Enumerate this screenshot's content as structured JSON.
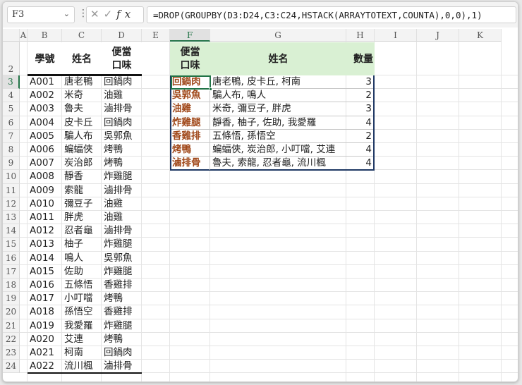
{
  "formula_bar": {
    "name_box": "F3",
    "cancel": "✕",
    "enter": "✓",
    "fx": "fx",
    "formula": "=DROP(GROUPBY(D3:D24,C3:C24,HSTACK(ARRAYTOTEXT,COUNTA),0,0),1)"
  },
  "columns": [
    "A",
    "B",
    "C",
    "D",
    "E",
    "F",
    "G",
    "H",
    "I",
    "J",
    "K"
  ],
  "rows": [
    "2",
    "3",
    "4",
    "5",
    "6",
    "7",
    "8",
    "9",
    "10",
    "11",
    "12",
    "13",
    "14",
    "15",
    "16",
    "17",
    "18",
    "19",
    "20",
    "21",
    "22",
    "23",
    "24"
  ],
  "source_table": {
    "headers": [
      "學號",
      "姓名",
      "便當\n口味"
    ],
    "header_lines": {
      "col3_line1": "便當",
      "col3_line2": "口味"
    },
    "rows": [
      [
        "A001",
        "唐老鴨",
        "回鍋肉"
      ],
      [
        "A002",
        "米奇",
        "油雞"
      ],
      [
        "A003",
        "魯夫",
        "滷排骨"
      ],
      [
        "A004",
        "皮卡丘",
        "回鍋肉"
      ],
      [
        "A005",
        "騙人布",
        "吳郭魚"
      ],
      [
        "A006",
        "蝙蝠俠",
        "烤鴨"
      ],
      [
        "A007",
        "炭治郎",
        "烤鴨"
      ],
      [
        "A008",
        "靜香",
        "炸雞腿"
      ],
      [
        "A009",
        "索龍",
        "滷排骨"
      ],
      [
        "A010",
        "彌豆子",
        "油雞"
      ],
      [
        "A011",
        "胖虎",
        "油雞"
      ],
      [
        "A012",
        "忍者龜",
        "滷排骨"
      ],
      [
        "A013",
        "柚子",
        "炸雞腿"
      ],
      [
        "A014",
        "鳴人",
        "吳郭魚"
      ],
      [
        "A015",
        "佐助",
        "炸雞腿"
      ],
      [
        "A016",
        "五條悟",
        "香雞排"
      ],
      [
        "A017",
        "小叮噹",
        "烤鴨"
      ],
      [
        "A018",
        "孫悟空",
        "香雞排"
      ],
      [
        "A019",
        "我愛羅",
        "炸雞腿"
      ],
      [
        "A020",
        "艾連",
        "烤鴨"
      ],
      [
        "A021",
        "柯南",
        "回鍋肉"
      ],
      [
        "A022",
        "流川楓",
        "滷排骨"
      ]
    ]
  },
  "result_table": {
    "header_line1": "便當",
    "header_line2": "口味",
    "header_name": "姓名",
    "header_count": "數量",
    "rows": [
      [
        "回鍋肉",
        "唐老鴨, 皮卡丘, 柯南",
        "3"
      ],
      [
        "吳郭魚",
        "騙人布, 鳴人",
        "2"
      ],
      [
        "油雞",
        "米奇, 彌豆子, 胖虎",
        "3"
      ],
      [
        "炸雞腿",
        "靜香, 柚子, 佐助, 我愛羅",
        "4"
      ],
      [
        "香雞排",
        "五條悟, 孫悟空",
        "2"
      ],
      [
        "烤鴨",
        "蝙蝠俠, 炭治郎, 小叮噹, 艾連",
        "4"
      ],
      [
        "滷排骨",
        "魯夫, 索龍, 忍者龜, 流川楓",
        "4"
      ]
    ]
  },
  "colors": {
    "header_fill": "#d9f0d3",
    "flavor_text": "#a0481a",
    "table_border": "#1f3864",
    "selection": "#217346"
  }
}
